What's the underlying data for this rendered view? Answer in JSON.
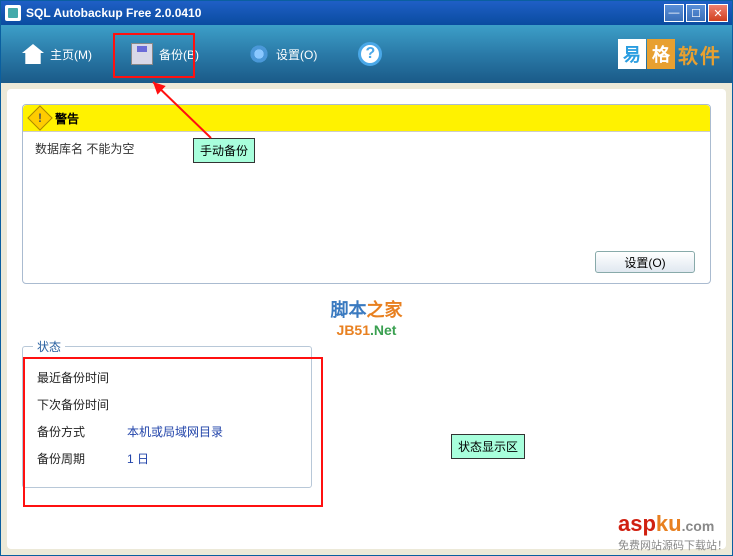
{
  "window": {
    "title": "SQL Autobackup Free 2.0.0410"
  },
  "toolbar": {
    "home": "主页(M)",
    "backup": "备份(B)",
    "settings": "设置(O)",
    "help_glyph": "?"
  },
  "logo": {
    "box1": "易",
    "box2": "格",
    "text": "软件"
  },
  "warning": {
    "title": "警告",
    "message": "数据库名 不能为空",
    "settings_btn": "设置(O)"
  },
  "brand": {
    "line1a": "脚本",
    "line1b": "之家",
    "line2a": "JB51",
    "line2b": ".Net"
  },
  "status": {
    "legend": "状态",
    "rows": [
      {
        "label": "最近备份时间",
        "value": ""
      },
      {
        "label": "下次备份时间",
        "value": ""
      },
      {
        "label": "备份方式",
        "value": "本机或局域网目录"
      },
      {
        "label": "备份周期",
        "value": "1 日"
      }
    ]
  },
  "annotations": {
    "manual_backup": "手动备份",
    "status_area": "状态显示区"
  },
  "watermark": {
    "a": "asp",
    "b": "ku",
    "c": ".com",
    "sub": "免费网站源码下载站！"
  }
}
